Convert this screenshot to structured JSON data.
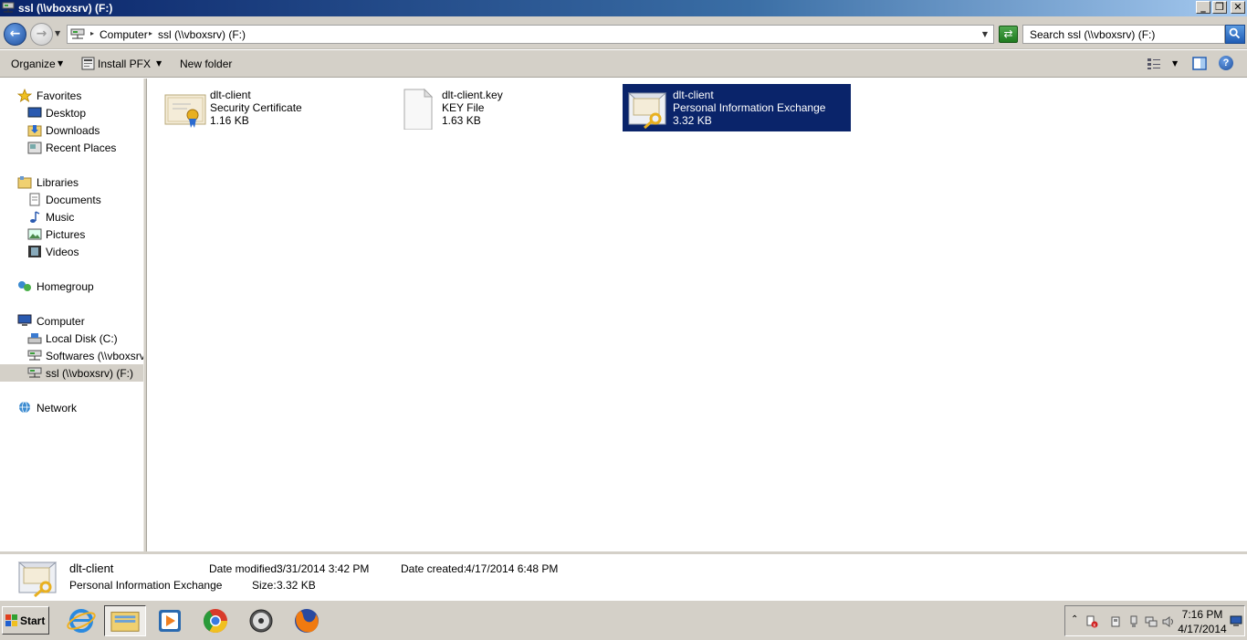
{
  "window": {
    "title": "ssl (\\\\vboxsrv) (F:)",
    "controls": {
      "minimize": "_",
      "maximize": "❐",
      "close": "✕"
    }
  },
  "address": {
    "crumbs": [
      "Computer",
      "ssl (\\\\vboxsrv) (F:)"
    ],
    "search_placeholder": "Search ssl (\\\\vboxsrv) (F:)"
  },
  "toolbar": {
    "organize": "Organize",
    "install_pfx": "Install PFX",
    "new_folder": "New folder"
  },
  "nav": {
    "favorites": {
      "label": "Favorites",
      "items": [
        "Desktop",
        "Downloads",
        "Recent Places"
      ]
    },
    "libraries": {
      "label": "Libraries",
      "items": [
        "Documents",
        "Music",
        "Pictures",
        "Videos"
      ]
    },
    "homegroup": "Homegroup",
    "computer": {
      "label": "Computer",
      "items": [
        "Local Disk (C:)",
        "Softwares (\\\\vboxsrv)",
        "ssl (\\\\vboxsrv) (F:)"
      ]
    },
    "network": "Network"
  },
  "files": [
    {
      "name": "dlt-client",
      "type": "Security Certificate",
      "size": "1.16 KB",
      "icon": "certificate-icon"
    },
    {
      "name": "dlt-client.key",
      "type": "KEY File",
      "size": "1.63 KB",
      "icon": "blank-file-icon"
    },
    {
      "name": "dlt-client",
      "type": "Personal Information Exchange",
      "size": "3.32 KB",
      "icon": "pfx-file-icon",
      "selected": true
    }
  ],
  "details": {
    "name": "dlt-client",
    "type": "Personal Information Exchange",
    "modified_label": "Date modified:",
    "modified": "3/31/2014 3:42 PM",
    "created_label": "Date created:",
    "created": "4/17/2014 6:48 PM",
    "size_label": "Size:",
    "size": "3.32 KB"
  },
  "taskbar": {
    "start": "Start",
    "apps": [
      "internet-explorer-icon",
      "windows-explorer-icon",
      "media-player-icon",
      "chrome-icon",
      "disc-icon",
      "firefox-icon"
    ],
    "clock_time": "7:16 PM",
    "clock_date": "4/17/2014"
  },
  "colors": {
    "selection": "#0a246a",
    "chrome": "#d4d0c8"
  }
}
